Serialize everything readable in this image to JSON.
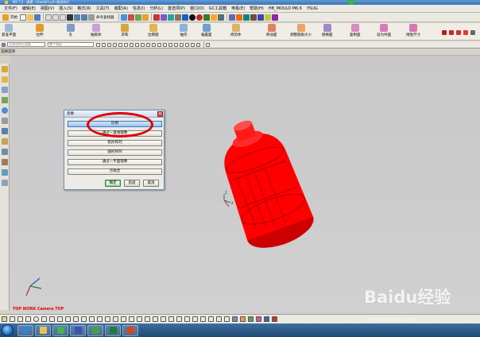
{
  "window": {
    "title": "NX 7.5 - 建模 - [model1.prt (修改的)]"
  },
  "menubar": {
    "items": [
      "文件(F)",
      "编辑(E)",
      "视图(V)",
      "插入(S)",
      "格式(R)",
      "工具(T)",
      "装配(A)",
      "信息(I)",
      "分析(L)",
      "首选项(P)",
      "窗口(O)",
      "GC工具箱",
      "电极(E)",
      "帮助(H)",
      "HB_MOULD M6.6",
      "YSUG"
    ]
  },
  "toolbar1": {
    "start_label": "开始",
    "command_finder_label": "命令查找器"
  },
  "toolbar2": {
    "items": [
      "基准平面",
      "拉伸",
      "孔",
      "抽取体",
      "求和",
      "边倒圆",
      "抽壳",
      "偏置面",
      "修剪体",
      "移动面",
      "调整圆角大小",
      "替换面",
      "复制面",
      "设为共面",
      "线性尺寸"
    ]
  },
  "toolbar3": {
    "filter_placeholder": "没有选择过滤器",
    "scope_placeholder": "整个装配"
  },
  "statusline": {
    "text": "选择选项"
  },
  "viewport": {
    "view_label": "TOP WORK Camera TOP",
    "model_color": "#ff0000",
    "background_color": "#cccccc"
  },
  "dialog": {
    "title": "变换",
    "options": [
      "比例",
      "通过一直线镜像",
      "矩形阵列",
      "圆形阵列",
      "通过一平面镜像",
      "点拟合"
    ],
    "selected_index": 0,
    "buttons": {
      "ok": "确定",
      "back": "后退",
      "cancel": "取消"
    }
  },
  "annotation": {
    "color": "#e00000"
  },
  "taskbar": {
    "apps": [
      "start-orb",
      "ie-icon",
      "explorer-icon",
      "screenshot-icon",
      "font-icon",
      "browser-icon",
      "excel-icon",
      "ppt-icon"
    ]
  },
  "watermark": {
    "text": "Baidu经验",
    "url": "jingyan.baidu.com"
  }
}
